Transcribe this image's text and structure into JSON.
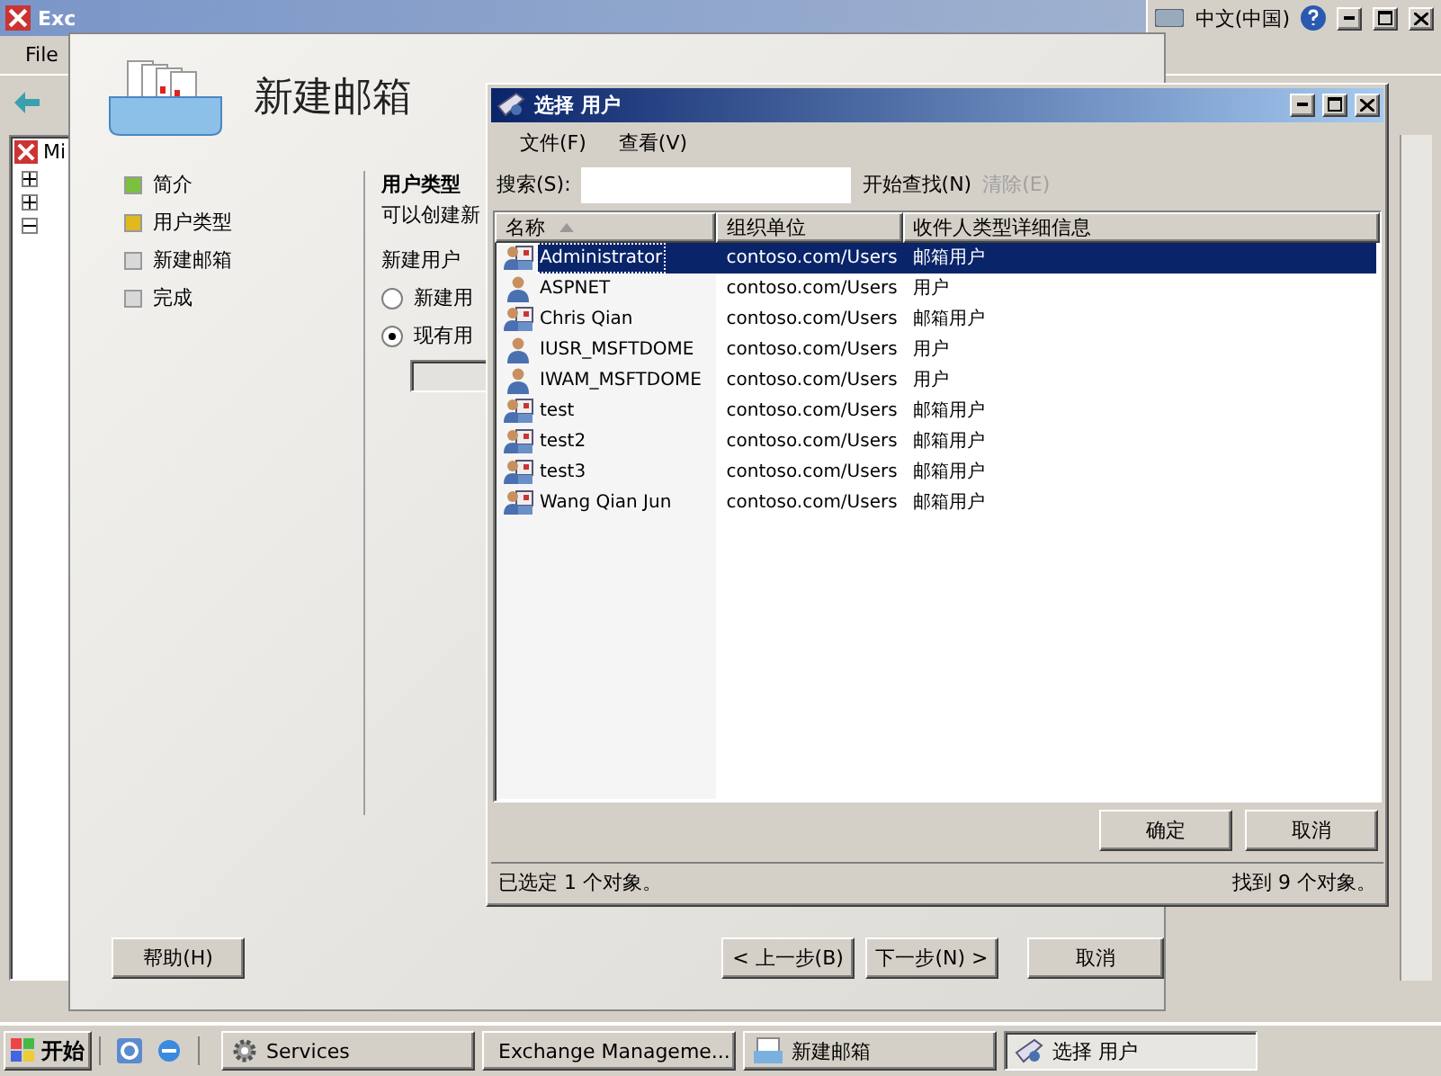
{
  "main_window": {
    "title": "Exc",
    "menu": [
      "File"
    ],
    "tree_root": "Mi",
    "tree_nodes": [
      {
        "expanded": false
      },
      {
        "expanded": false
      },
      {
        "expanded": true
      }
    ]
  },
  "language_bar": {
    "language": "中文(中国)"
  },
  "wizard": {
    "title": "新建邮箱",
    "steps": [
      {
        "label": "简介",
        "color": "#7cc040"
      },
      {
        "label": "用户类型",
        "color": "#e0b820"
      },
      {
        "label": "新建邮箱",
        "color": "#d8d8d8"
      },
      {
        "label": "完成",
        "color": "#d8d8d8"
      }
    ],
    "heading": "用户类型",
    "description": "可以创建新",
    "group_label": "新建用户",
    "options": [
      {
        "label": "新建用",
        "selected": false
      },
      {
        "label": "现有用",
        "selected": true
      }
    ],
    "help_button": "帮助(H)",
    "back_button": "< 上一步(B)",
    "next_button": "下一步(N) >",
    "cancel_button": "取消"
  },
  "dialog": {
    "title": "选择 用户",
    "menu": [
      "文件(F)",
      "查看(V)"
    ],
    "search_label": "搜索(S):",
    "search_button": "开始查找(N)",
    "clear_button": {
      "label": "清除(E)",
      "disabled": true
    },
    "columns": [
      {
        "label": "名称",
        "sorted": true
      },
      {
        "label": "组织单位",
        "sorted": false
      },
      {
        "label": "收件人类型详细信息",
        "sorted": false
      }
    ],
    "rows": [
      {
        "name": "Administrator",
        "unit": "contoso.com/Users",
        "type": "邮箱用户",
        "kind": "mailbox",
        "selected": true
      },
      {
        "name": "ASPNET",
        "unit": "contoso.com/Users",
        "type": "用户",
        "kind": "user",
        "selected": false
      },
      {
        "name": "Chris Qian",
        "unit": "contoso.com/Users",
        "type": "邮箱用户",
        "kind": "mailbox",
        "selected": false
      },
      {
        "name": "IUSR_MSFTDOME",
        "unit": "contoso.com/Users",
        "type": "用户",
        "kind": "user",
        "selected": false
      },
      {
        "name": "IWAM_MSFTDOME",
        "unit": "contoso.com/Users",
        "type": "用户",
        "kind": "user",
        "selected": false
      },
      {
        "name": "test",
        "unit": "contoso.com/Users",
        "type": "邮箱用户",
        "kind": "mailbox",
        "selected": false
      },
      {
        "name": "test2",
        "unit": "contoso.com/Users",
        "type": "邮箱用户",
        "kind": "mailbox",
        "selected": false
      },
      {
        "name": "test3",
        "unit": "contoso.com/Users",
        "type": "邮箱用户",
        "kind": "mailbox",
        "selected": false
      },
      {
        "name": "Wang Qian Jun",
        "unit": "contoso.com/Users",
        "type": "邮箱用户",
        "kind": "mailbox",
        "selected": false
      }
    ],
    "ok_button": "确定",
    "cancel_button": "取消",
    "status_left": "已选定 1 个对象。",
    "status_right": "找到 9 个对象。"
  },
  "taskbar": {
    "start": "开始",
    "tasks": [
      {
        "label": "Services",
        "kind": "services",
        "selected": false
      },
      {
        "label": "Exchange Manageme...",
        "kind": "exchange",
        "selected": false
      },
      {
        "label": "新建邮箱",
        "kind": "mailbox",
        "selected": false
      },
      {
        "label": "选择 用户",
        "kind": "users",
        "selected": true
      }
    ]
  }
}
